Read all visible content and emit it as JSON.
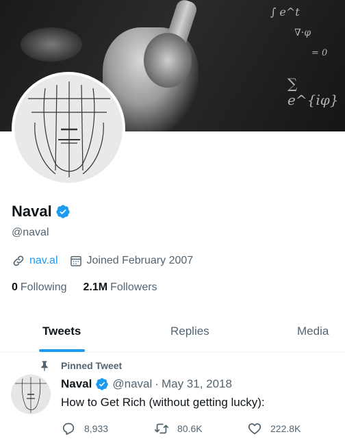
{
  "profile": {
    "name": "Naval",
    "handle": "@naval",
    "website": "nav.al",
    "joined": "Joined February 2007",
    "following_count": "0",
    "following_label": "Following",
    "followers_count": "2.1M",
    "followers_label": "Followers"
  },
  "tabs": [
    {
      "label": "Tweets",
      "active": true
    },
    {
      "label": "Replies",
      "active": false
    },
    {
      "label": "Media",
      "active": false
    }
  ],
  "pinned_tweet": {
    "pinned_label": "Pinned Tweet",
    "author_name": "Naval",
    "author_handle": "@naval",
    "separator": "·",
    "date": "May 31, 2018",
    "text": "How to Get Rich (without getting lucky):",
    "replies": "8,933",
    "retweets": "80.6K",
    "likes": "222.8K"
  },
  "icons": {
    "verified": "verified-badge-icon",
    "link": "link-icon",
    "calendar": "calendar-icon",
    "pin": "pin-icon",
    "reply": "reply-icon",
    "retweet": "retweet-icon",
    "like": "heart-icon"
  },
  "colors": {
    "accent": "#1d9bf0",
    "text_primary": "#0f1419",
    "text_secondary": "#536471"
  }
}
